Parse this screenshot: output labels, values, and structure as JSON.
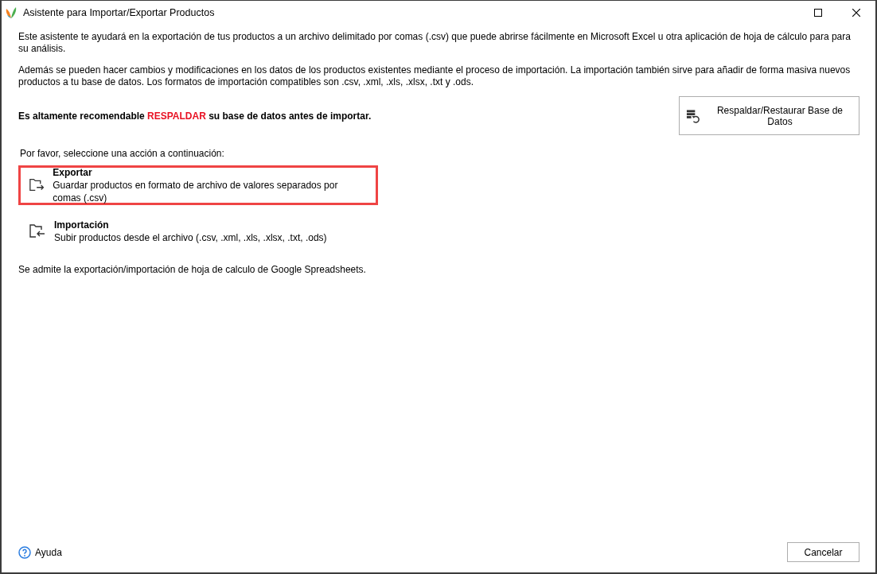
{
  "window": {
    "title": "Asistente para Importar/Exportar Productos"
  },
  "intro": [
    "Este asistente te ayudará en la exportación de tus productos a un archivo delimitado por comas (.csv) que puede abrirse fácilmente en Microsoft Excel u otra aplicación de hoja de cálculo para para su análisis.",
    "Además se pueden hacer cambios y modificaciones en los datos de los productos existentes mediante el proceso de importación. La importación también sirve para añadir de forma masiva nuevos productos a tu base de datos. Los formatos de importación compatibles son .csv, .xml, .xls, .xlsx, .txt y .ods."
  ],
  "warning": {
    "before": "Es altamente recomendable ",
    "emphasis": "RESPALDAR",
    "after": " su base de datos antes de importar."
  },
  "backup_button": "Respaldar/Restaurar Base de Datos",
  "prompt": "Por favor, seleccione una acción a continuación:",
  "actions": [
    {
      "kind": "export",
      "title": "Exportar",
      "description": "Guardar productos en formato de archivo de valores separados por comas (.csv)",
      "selected": true
    },
    {
      "kind": "import",
      "title": "Importación",
      "description": "Subir productos desde el archivo (.csv, .xml, .xls, .xlsx, .txt, .ods)",
      "selected": false
    }
  ],
  "note": "Se admite la exportación/importación de hoja de calculo de Google Spreadsheets.",
  "help_link": "Ayuda",
  "cancel_button": "Cancelar"
}
